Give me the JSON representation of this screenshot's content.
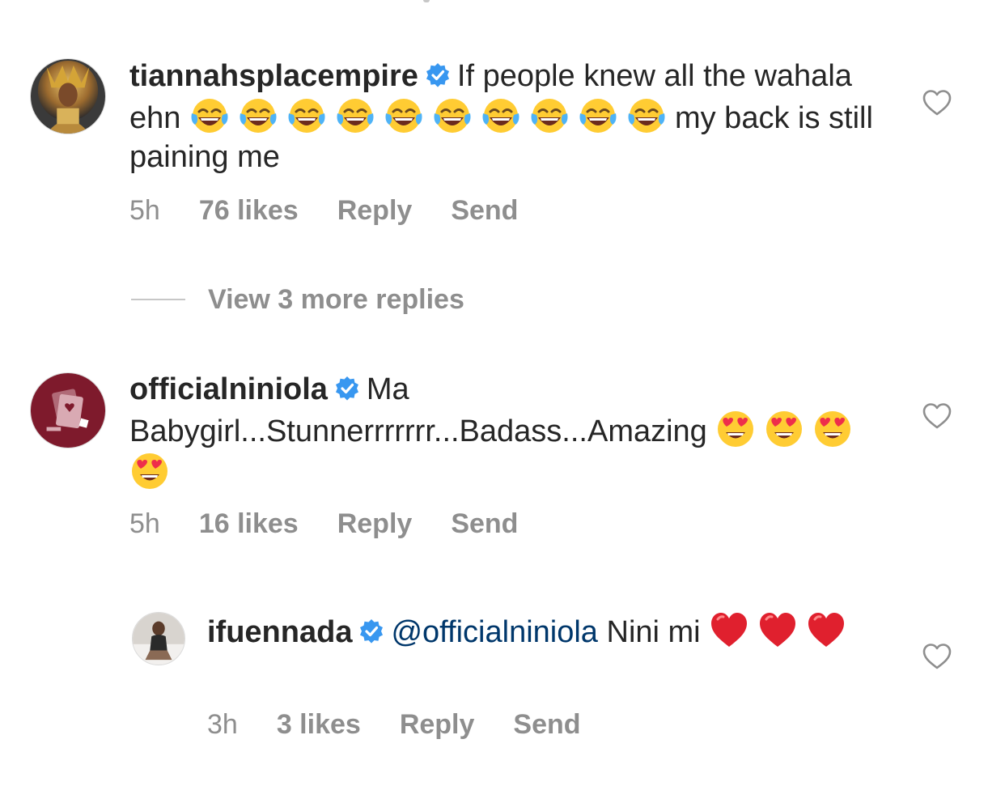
{
  "comments": [
    {
      "username": "tiannahsplacempire",
      "verified": true,
      "text_a": "If people knew all the wahala ehn",
      "emoji_a": "face-with-tears-of-joy",
      "emoji_a_count": 10,
      "text_b": "my back is still paining me",
      "time": "5h",
      "likes": "76 likes",
      "reply": "Reply",
      "send": "Send",
      "liked": false
    },
    {
      "username": "officialniniola",
      "verified": true,
      "text_a": "Ma Babygirl...Stunnerrrrrrr...Badass...Amazing",
      "emoji_a": "smiling-face-with-heart-eyes",
      "emoji_a_count": 4,
      "time": "5h",
      "likes": "16 likes",
      "reply": "Reply",
      "send": "Send",
      "liked": false
    }
  ],
  "reply": {
    "username": "ifuennada",
    "verified": true,
    "mention": "@officialniniola",
    "text_a": "Nini mi",
    "emoji_a": "red-heart",
    "emoji_a_count": 3,
    "time": "3h",
    "likes": "3 likes",
    "reply": "Reply",
    "send": "Send",
    "liked": false
  },
  "view_replies": "View 3 more replies",
  "colors": {
    "text": "#262626",
    "secondary": "#8e8e8e",
    "verified_blue": "#3897f0",
    "mention": "#00376b",
    "divider": "#c7c7c7"
  }
}
